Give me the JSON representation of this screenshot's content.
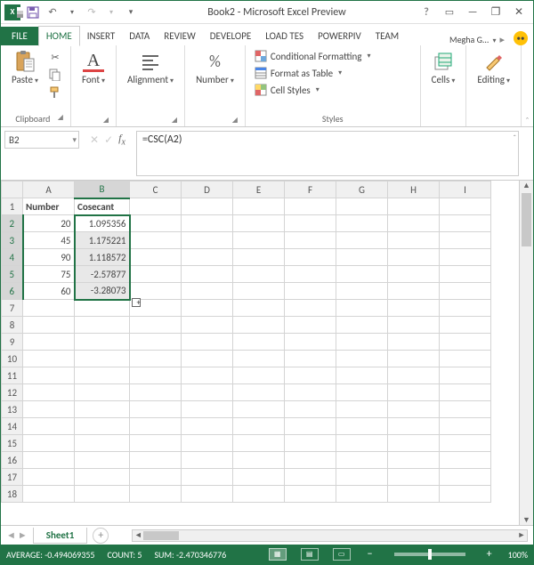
{
  "title": "Book2 - Microsoft Excel Preview",
  "signin": "Megha G...",
  "tabs": {
    "file": "FILE",
    "home": "HOME",
    "insert": "INSERT",
    "data": "DATA",
    "review": "REVIEW",
    "developer": "DEVELOPE",
    "loadtest": "LOAD TES",
    "powerpivot": "POWERPIV",
    "team": "TEAM"
  },
  "ribbon": {
    "clipboard": {
      "paste": "Paste",
      "label": "Clipboard"
    },
    "font": {
      "btn": "Font",
      "label": ""
    },
    "alignment": {
      "btn": "Alignment",
      "label": ""
    },
    "number": {
      "btn": "Number",
      "label": ""
    },
    "styles": {
      "cond": "Conditional Formatting",
      "table": "Format as Table",
      "cell": "Cell Styles",
      "label": "Styles"
    },
    "cells": {
      "btn": "Cells",
      "label": ""
    },
    "editing": {
      "btn": "Editing",
      "label": ""
    }
  },
  "namebox": "B2",
  "formula": "=CSC(A2)",
  "columns": [
    "A",
    "B",
    "C",
    "D",
    "E",
    "F",
    "G",
    "H",
    "I"
  ],
  "row_headers": [
    "1",
    "2",
    "3",
    "4",
    "5",
    "6",
    "7",
    "8",
    "9",
    "10",
    "11",
    "12",
    "13",
    "14",
    "15",
    "16",
    "17",
    "18"
  ],
  "data_headers": {
    "A": "Number",
    "B": "Cosecant"
  },
  "rows": [
    {
      "A": "20",
      "B": "1.095356"
    },
    {
      "A": "45",
      "B": "1.175221"
    },
    {
      "A": "90",
      "B": "1.118572"
    },
    {
      "A": "75",
      "B": "-2.57877"
    },
    {
      "A": "60",
      "B": "-3.28073"
    }
  ],
  "sheet_tab": "Sheet1",
  "status": {
    "average_label": "AVERAGE:",
    "average": "-0.494069355",
    "count_label": "COUNT:",
    "count": "5",
    "sum_label": "SUM:",
    "sum": "-2.470346776",
    "zoom": "100%"
  }
}
